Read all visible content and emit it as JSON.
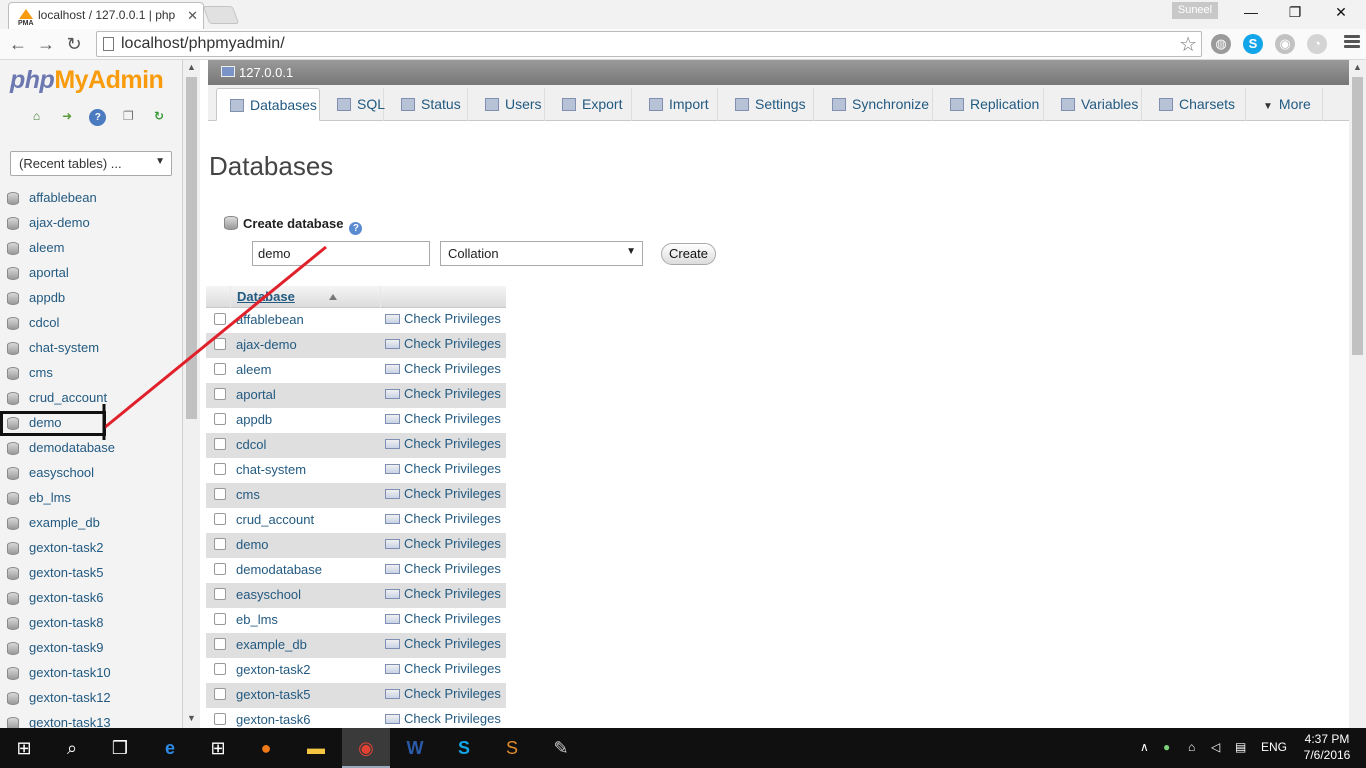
{
  "browser": {
    "tab_title": "localhost / 127.0.0.1 | php",
    "url": "localhost/phpmyadmin/",
    "profile_name": "Suneel"
  },
  "pma_nav": {
    "logo_part1": "php",
    "logo_part2": "MyAdmin",
    "recent_tables": "(Recent tables) ...",
    "databases": [
      "affablebean",
      "ajax-demo",
      "aleem",
      "aportal",
      "appdb",
      "cdcol",
      "chat-system",
      "cms",
      "crud_account",
      "demo",
      "demodatabase",
      "easyschool",
      "eb_lms",
      "example_db",
      "gexton-task2",
      "gexton-task5",
      "gexton-task6",
      "gexton-task8",
      "gexton-task9",
      "gexton-task10",
      "gexton-task12",
      "gexton-task13"
    ],
    "highlighted": "demo"
  },
  "server": {
    "name": "127.0.0.1"
  },
  "tabs": [
    {
      "label": "Databases",
      "active": true
    },
    {
      "label": "SQL"
    },
    {
      "label": "Status"
    },
    {
      "label": "Users"
    },
    {
      "label": "Export"
    },
    {
      "label": "Import"
    },
    {
      "label": "Settings"
    },
    {
      "label": "Synchronize"
    },
    {
      "label": "Replication"
    },
    {
      "label": "Variables"
    },
    {
      "label": "Charsets"
    },
    {
      "label": "More"
    }
  ],
  "main": {
    "page_title": "Databases",
    "create_heading": "Create database",
    "db_name_value": "demo",
    "collation_label": "Collation",
    "create_button": "Create",
    "table_header": "Database",
    "action_label": "Check Privileges",
    "rows": [
      "affablebean",
      "ajax-demo",
      "aleem",
      "aportal",
      "appdb",
      "cdcol",
      "chat-system",
      "cms",
      "crud_account",
      "demo",
      "demodatabase",
      "easyschool",
      "eb_lms",
      "example_db",
      "gexton-task2",
      "gexton-task5",
      "gexton-task6"
    ]
  },
  "taskbar": {
    "language": "ENG",
    "time": "4:37 PM",
    "date": "7/6/2016"
  },
  "colors": {
    "link": "#235a81",
    "annotation_line": "#e0202a",
    "logo_php": "#6c78af",
    "logo_myadmin": "#f89c0e"
  }
}
